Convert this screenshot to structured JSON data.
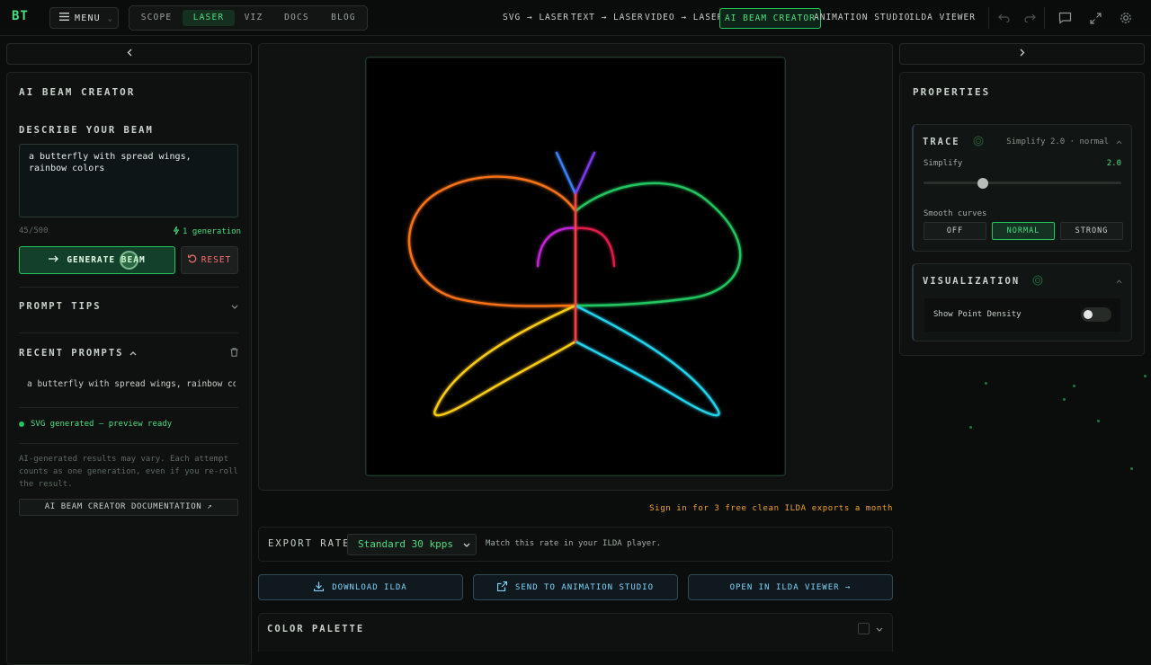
{
  "topbar": {
    "logo": "BT",
    "menu_label": "MENU",
    "tabs": [
      {
        "label": "SCOPE",
        "active": false
      },
      {
        "label": "LASER",
        "active": true
      },
      {
        "label": "VIZ",
        "active": false
      },
      {
        "label": "DOCS",
        "active": false
      },
      {
        "label": "BLOG",
        "active": false
      }
    ],
    "links": [
      {
        "label": "SVG → LASER",
        "active": false
      },
      {
        "label": "TEXT → LASER",
        "active": false
      },
      {
        "label": "VIDEO → LASER",
        "active": false
      },
      {
        "label": "AI BEAM CREATOR",
        "active": true
      },
      {
        "label": "ANIMATION STUDIO",
        "active": false
      },
      {
        "label": "ILDA VIEWER",
        "active": false
      }
    ],
    "icons": [
      "undo-icon",
      "redo-icon",
      "chat-icon",
      "expand-icon",
      "settings-icon"
    ]
  },
  "left": {
    "title": "AI BEAM CREATOR",
    "describe_label": "DESCRIBE YOUR BEAM",
    "prompt_value": "a butterfly with spread wings, rainbow colors",
    "char_count": "45/500",
    "generation_count": "1 generation",
    "generate_label": "GENERATE BEAM",
    "reset_label": "RESET",
    "tips_label": "PROMPT TIPS",
    "recent_label": "RECENT PROMPTS",
    "recent_items": [
      "a butterfly with spread wings, rainbow colo…"
    ],
    "status": "SVG generated — preview ready",
    "note": "AI-generated results may vary. Each attempt counts as one generation, even if you re-roll the result.",
    "doc_link": "AI BEAM CREATOR DOCUMENTATION ↗"
  },
  "center": {
    "signin_notice": "Sign in for 3 free clean ILDA exports a month",
    "export_rate_label": "EXPORT RATE",
    "export_rate_value": "Standard 30 kpps",
    "export_rate_hint": "Match this rate in your ILDA player.",
    "download_label": "DOWNLOAD ILDA",
    "send_label": "SEND TO ANIMATION STUDIO",
    "open_label": "OPEN IN ILDA VIEWER →",
    "palette_label": "COLOR PALETTE"
  },
  "right": {
    "title": "PROPERTIES",
    "trace": {
      "title": "TRACE",
      "summary": "Simplify 2.0 · normal",
      "simplify_label": "Simplify",
      "simplify_value": "2.0",
      "simplify_fraction": 0.3,
      "smooth_label": "Smooth curves",
      "smooth_options": [
        "OFF",
        "NORMAL",
        "STRONG"
      ],
      "smooth_selected": "NORMAL"
    },
    "visualization": {
      "title": "VISUALIZATION",
      "density_label": "Show Point Density",
      "density_on": false
    }
  },
  "colors": {
    "accent": "#22c55e",
    "warning": "#f5a524",
    "danger": "#f87171",
    "link": "#7dd3fc"
  }
}
